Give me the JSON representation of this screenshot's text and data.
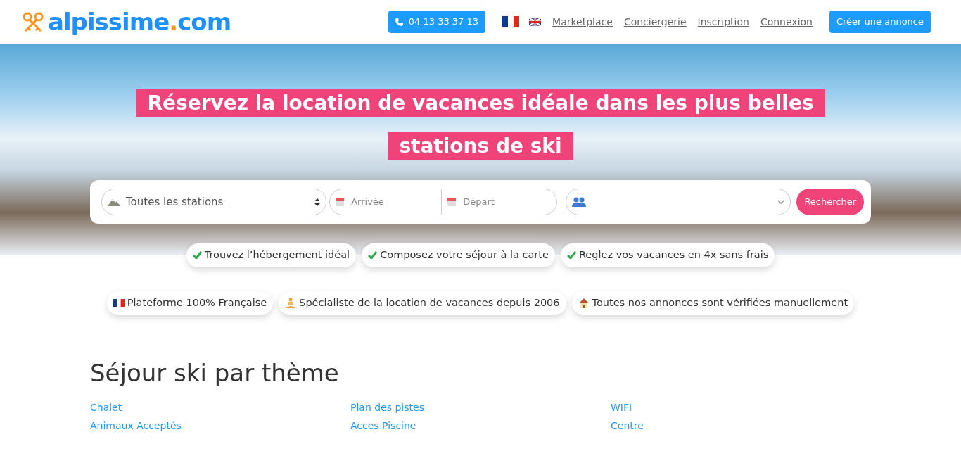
{
  "header": {
    "logo": {
      "name": "alpissime",
      "dot": ".",
      "tld": "com"
    },
    "phone": "04 13 33 37 13",
    "languages": [
      {
        "kind": "french",
        "selected": true
      },
      {
        "kind": "british",
        "selected": false
      }
    ],
    "nav_links": [
      "Marketplace",
      "Conciergerie",
      "Inscription",
      "Connexion"
    ],
    "cta": "Créer une annonce"
  },
  "hero": {
    "title_lines": [
      "Réservez la location de vacances idéale dans les plus belles",
      "stations de ski"
    ],
    "search": {
      "station": "Toutes les stations",
      "arrival_placeholder": "Arrivée",
      "departure_placeholder": "Départ",
      "button": "Rechercher"
    }
  },
  "benefits": [
    "Trouvez l’hébergement idéal",
    "Composez votre séjour à la carte",
    "Reglez vos vacances en 4x sans frais"
  ],
  "highlights": [
    {
      "kind": "flag",
      "text": "Plateforme 100% Française"
    },
    {
      "kind": "person",
      "text": "Spécialiste de la location de vacances depuis 2006"
    },
    {
      "kind": "house",
      "text": "Toutes nos annonces sont vérifiées manuellement"
    }
  ],
  "themes": {
    "title": "Séjour ski par thème",
    "links": [
      "Chalet",
      "Plan des pistes",
      "WIFI",
      "Animaux Acceptés",
      "Acces Piscine",
      "Centre"
    ]
  }
}
